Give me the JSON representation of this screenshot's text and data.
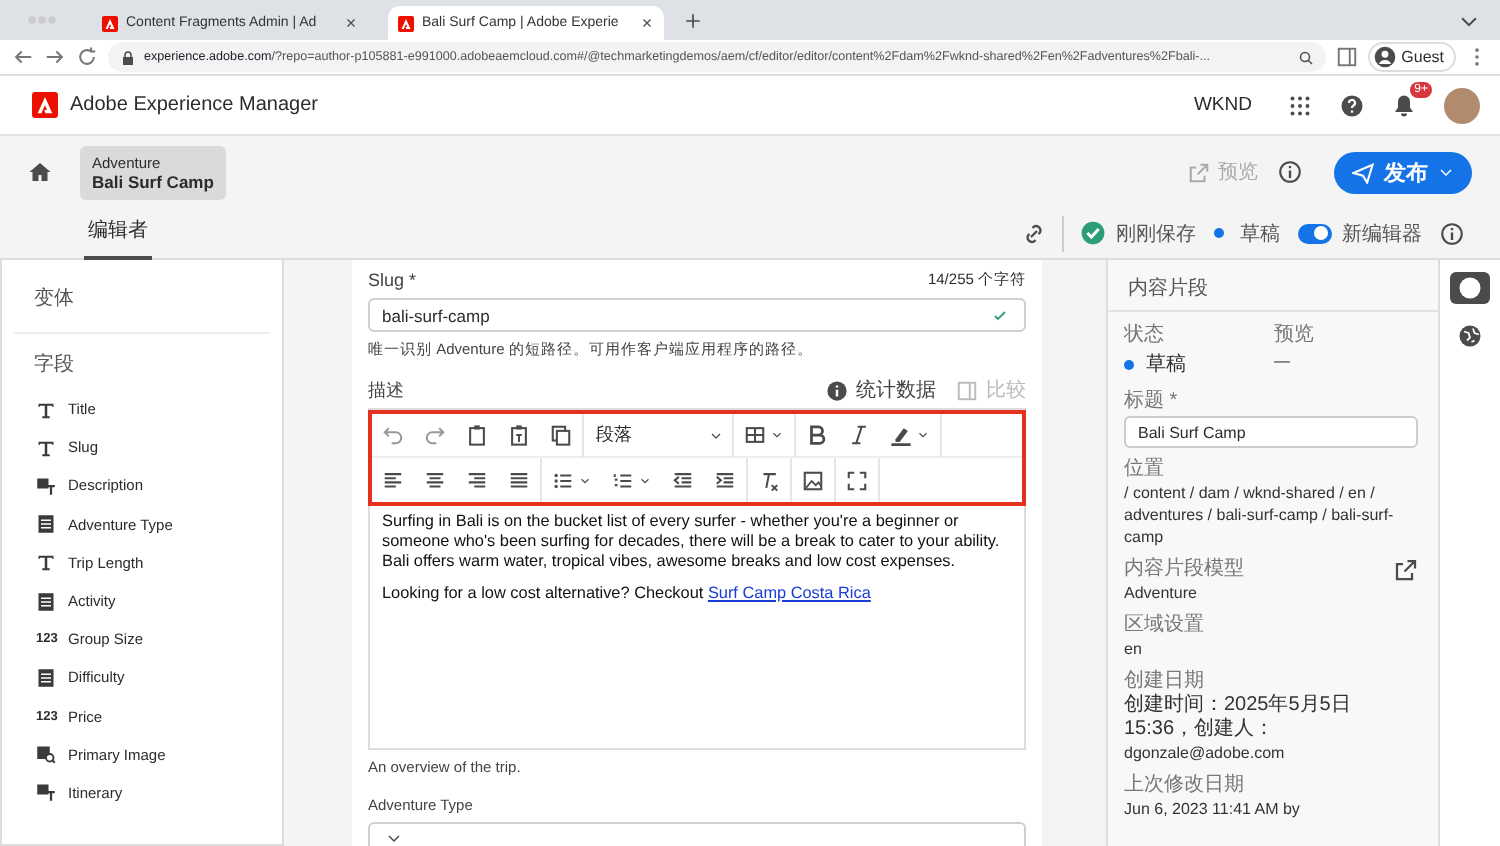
{
  "browser": {
    "tabs": [
      {
        "title": "Content Fragments Admin | Ad",
        "selected": false
      },
      {
        "title": "Bali Surf Camp | Adobe Experie",
        "selected": true
      }
    ],
    "url_host": "experience.adobe.com",
    "url_rest": "/?repo=author-p105881-e991000.adobeaemcloud.com#/@techmarketingdemos/aem/cf/editor/editor/content%2Fdam%2Fwknd-shared%2Fen%2Fadventures%2Fbali-...",
    "profile": "Guest"
  },
  "app": {
    "name": "Adobe Experience Manager",
    "org": "WKND",
    "notification_badge": "9+"
  },
  "header": {
    "model": "Adventure",
    "title": "Bali Surf Camp",
    "preview": "预览",
    "publish": "发布"
  },
  "editor_bar": {
    "tabs": [
      {
        "label": "编辑者",
        "selected": true
      }
    ],
    "save_status": "刚刚保存",
    "status": "草稿",
    "toggle": {
      "label": "新编辑器",
      "on": true
    }
  },
  "sidebar": {
    "variations": "变体",
    "fields_heading": "字段",
    "fields": [
      {
        "label": "Title",
        "kind": "text"
      },
      {
        "label": "Slug",
        "kind": "text"
      },
      {
        "label": "Description",
        "kind": "richtext"
      },
      {
        "label": "Adventure Type",
        "kind": "enum"
      },
      {
        "label": "Trip Length",
        "kind": "text"
      },
      {
        "label": "Activity",
        "kind": "enum"
      },
      {
        "label": "Group Size",
        "kind": "number",
        "badge": "123"
      },
      {
        "label": "Difficulty",
        "kind": "enum"
      },
      {
        "label": "Price",
        "kind": "number",
        "badge": "123"
      },
      {
        "label": "Primary Image",
        "kind": "image"
      },
      {
        "label": "Itinerary",
        "kind": "richtext"
      }
    ]
  },
  "form": {
    "slug": {
      "label": "Slug *",
      "count": "14/255 个字符",
      "value": "bali-surf-camp",
      "help": "唯一识别 Adventure 的短路径。可用作客户端应用程序的路径。"
    },
    "description": {
      "label": "描述",
      "stats": "统计数据",
      "compare": "比较",
      "format": "段落",
      "paragraphs": [
        "Surfing in Bali is on the bucket list of every surfer - whether you're a beginner or someone who's been surfing for decades, there will be a break to cater to your ability. Bali offers warm water, tropical vibes, awesome breaks and low cost expenses.",
        "Looking for a low cost alternative? Checkout "
      ],
      "link": "Surf Camp Costa Rica",
      "help": "An overview of the trip."
    },
    "adventure_type": {
      "label": "Adventure Type"
    }
  },
  "panel": {
    "heading": "内容片段",
    "status_label": "状态",
    "preview_label": "预览",
    "status": "草稿",
    "preview": "—",
    "title_label": "标题 *",
    "title": "Bali Surf Camp",
    "location_label": "位置",
    "location": "/ content / dam / wknd-shared / en / adventures / bali-surf-camp / bali-surf-camp",
    "model_label": "内容片段模型",
    "model": "Adventure",
    "locale_label": "区域设置",
    "locale": "en",
    "created_label": "创建日期",
    "created": "创建时间：2025年5月5日 15:36，创建人：",
    "created_by": "dgonzale@adobe.com",
    "modified_label": "上次修改日期",
    "modified": "Jun 6, 2023 11:41 AM by"
  }
}
